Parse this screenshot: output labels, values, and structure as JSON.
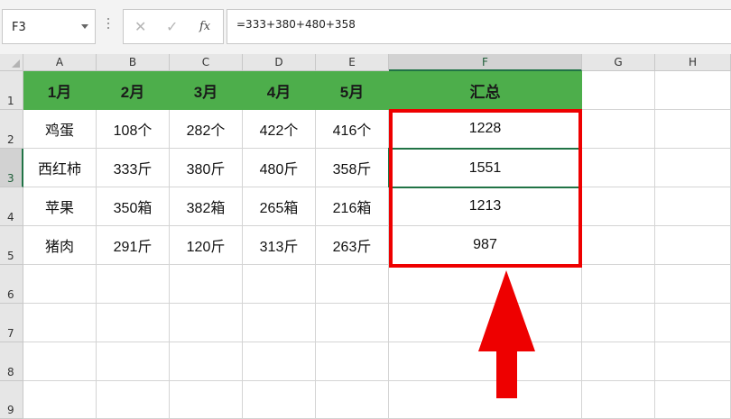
{
  "name_box": {
    "value": "F3"
  },
  "formula_bar": {
    "cancel_icon": "✕",
    "confirm_icon": "✓",
    "fx_icon": "fx",
    "formula": "=333+380+480+358"
  },
  "columns": [
    "A",
    "B",
    "C",
    "D",
    "E",
    "F",
    "G",
    "H"
  ],
  "rows": [
    "1",
    "2",
    "3",
    "4",
    "5",
    "6",
    "7",
    "8",
    "9"
  ],
  "header_row": [
    "1月",
    "2月",
    "3月",
    "4月",
    "5月",
    "汇总"
  ],
  "data_rows": [
    [
      "鸡蛋",
      "108个",
      "282个",
      "422个",
      "416个",
      "1228"
    ],
    [
      "西红柿",
      "333斤",
      "380斤",
      "480斤",
      "358斤",
      "1551"
    ],
    [
      "苹果",
      "350箱",
      "382箱",
      "265箱",
      "216箱",
      "1213"
    ],
    [
      "猪肉",
      "291斤",
      "120斤",
      "313斤",
      "263斤",
      "987"
    ]
  ],
  "selection": {
    "active_cell": "F3",
    "selected_column": "F",
    "selected_row": "3"
  },
  "colors": {
    "header_fill": "#4dae4b",
    "selection_green": "#217346",
    "highlight_red": "#ee0000"
  },
  "annotation_icons": [
    "red-highlight-box",
    "red-up-arrow-icon"
  ]
}
